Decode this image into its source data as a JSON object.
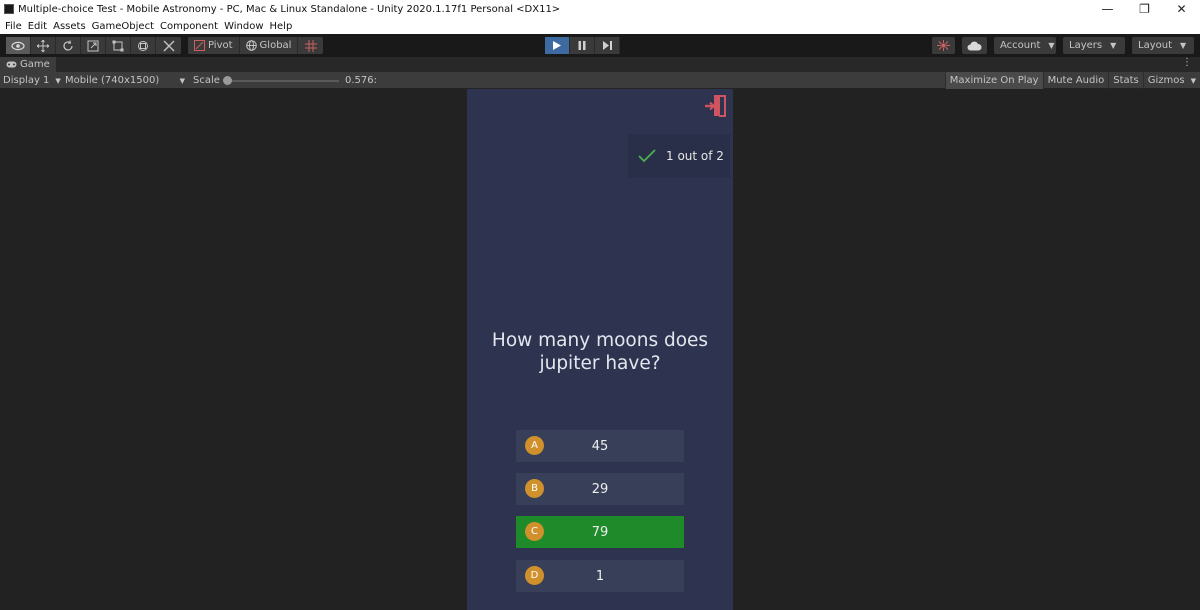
{
  "window": {
    "title": "Multiple-choice Test - Mobile Astronomy - PC, Mac & Linux Standalone - Unity 2020.1.17f1 Personal <DX11>",
    "controls": [
      "—",
      "❐",
      "✕"
    ]
  },
  "menu": [
    "File",
    "Edit",
    "Assets",
    "GameObject",
    "Component",
    "Window",
    "Help"
  ],
  "toolbar": {
    "pivot_label": "Pivot",
    "global_label": "Global",
    "account_label": "Account",
    "layers_label": "Layers",
    "layout_label": "Layout"
  },
  "game_tab": {
    "label": "Game",
    "display": "Display 1",
    "resolution": "Mobile (740x1500)",
    "scale_label": "Scale",
    "scale_value": "0.576:",
    "maximize_on_play": "Maximize On Play",
    "mute_audio": "Mute Audio",
    "stats": "Stats",
    "gizmos": "Gizmos"
  },
  "game": {
    "score_text": "1 out of 2",
    "question": "How many moons does jupiter have?",
    "answers": [
      {
        "letter": "A",
        "value": "45",
        "state": "normal"
      },
      {
        "letter": "B",
        "value": "29",
        "state": "normal"
      },
      {
        "letter": "C",
        "value": "79",
        "state": "correct"
      },
      {
        "letter": "D",
        "value": "1",
        "state": "normal"
      }
    ],
    "colors": {
      "panel": "#2e3350",
      "answer_bg": "#374058",
      "correct_bg": "#1e8a2a",
      "badge": "#d0902c",
      "exit_icon": "#d0545f",
      "check": "#4caf50"
    }
  }
}
